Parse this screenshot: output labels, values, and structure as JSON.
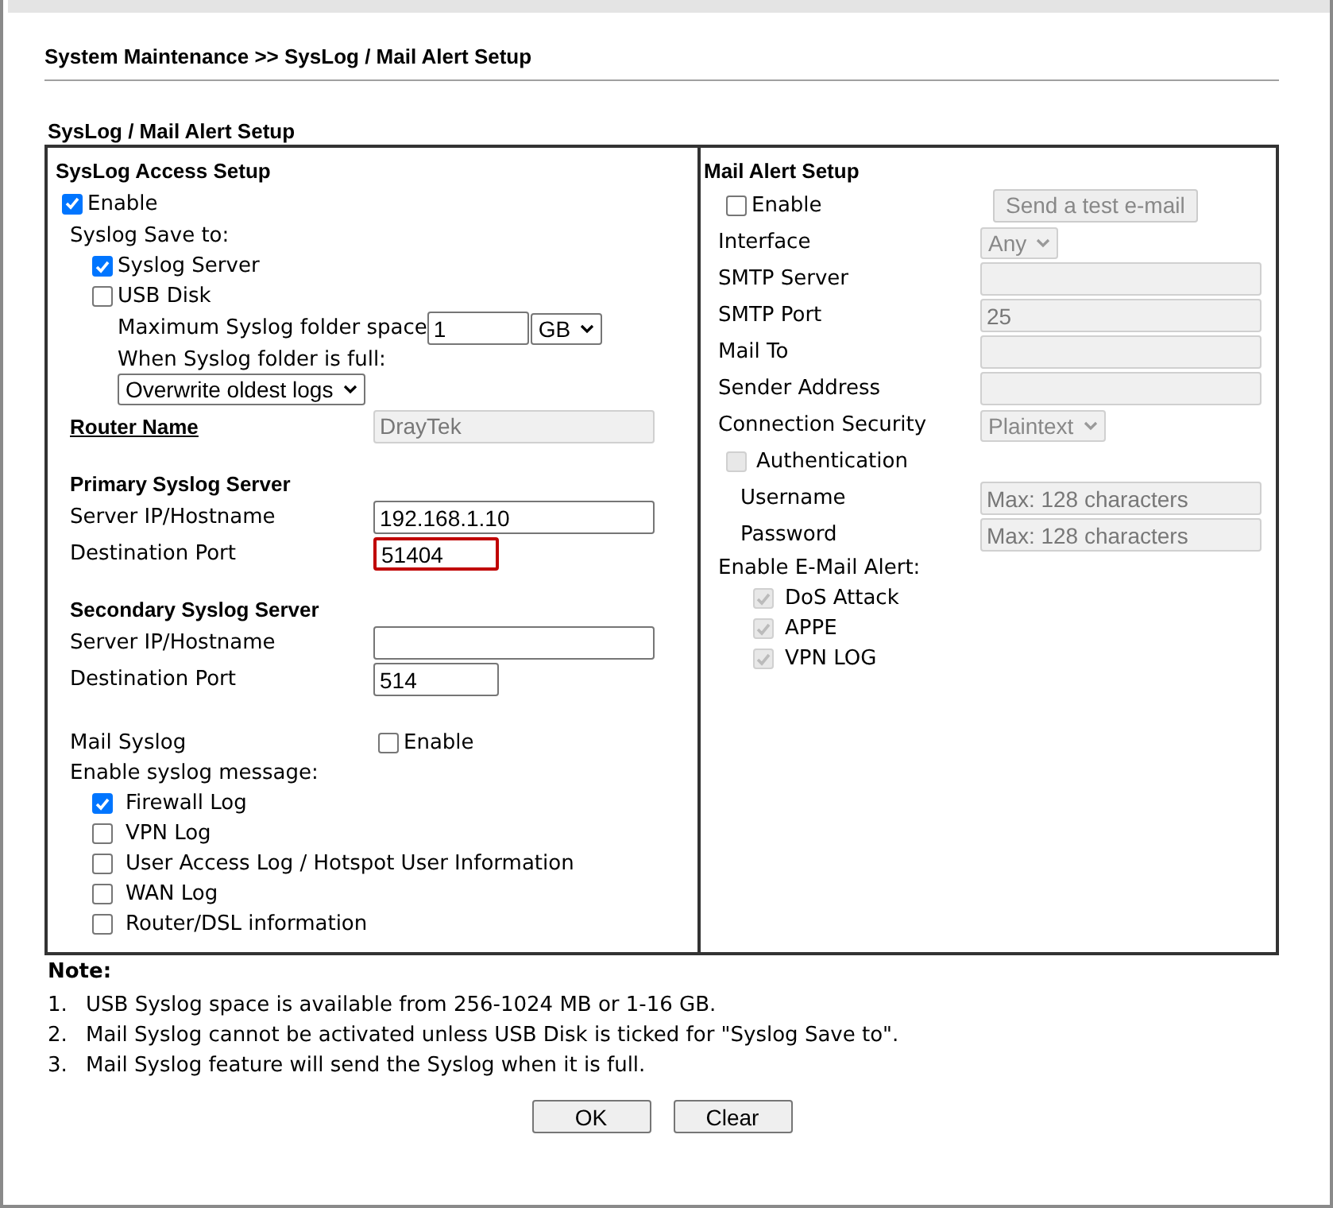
{
  "breadcrumb": "System Maintenance >> SysLog / Mail Alert Setup",
  "section_title": "SysLog / Mail Alert Setup",
  "syslog": {
    "title": "SysLog Access Setup",
    "enable": {
      "label": "Enable",
      "checked": true
    },
    "save_to_label": "Syslog Save to:",
    "save_targets": [
      {
        "label": "Syslog Server",
        "checked": true
      },
      {
        "label": "USB Disk",
        "checked": false
      }
    ],
    "max_space": {
      "label": "Maximum Syslog folder space",
      "value": "1",
      "unit": "GB"
    },
    "full_label": "When Syslog folder is full:",
    "full_action": "Overwrite oldest logs",
    "router_name": {
      "label": "Router Name",
      "value": "DrayTek",
      "disabled": true
    },
    "servers": [
      {
        "title": "Primary Syslog Server",
        "fields": [
          {
            "label": "Server IP/Hostname",
            "value": "192.168.1.10",
            "error": false
          },
          {
            "label": "Destination Port",
            "value": "51404",
            "error": true
          }
        ]
      },
      {
        "title": "Secondary Syslog Server",
        "fields": [
          {
            "label": "Server IP/Hostname",
            "error": false
          },
          {
            "label": "Destination Port",
            "value": "514",
            "error": false
          }
        ]
      }
    ],
    "mail_syslog": {
      "label": "Mail Syslog",
      "checkbox_label": "Enable",
      "checked": false
    },
    "messages": {
      "label": "Enable syslog message:",
      "items": [
        {
          "label": "Firewall Log",
          "checked": true
        },
        {
          "label": "VPN Log",
          "checked": false
        },
        {
          "label": "User Access Log / Hotspot User Information",
          "checked": false
        },
        {
          "label": "WAN Log",
          "checked": false
        },
        {
          "label": "Router/DSL information",
          "checked": false
        }
      ]
    }
  },
  "mail_alert": {
    "title": "Mail Alert Setup",
    "enable": {
      "label": "Enable",
      "checked": false
    },
    "test_button": {
      "label": "Send a test e-mail",
      "disabled": true
    },
    "rows": [
      {
        "kind": "select",
        "label": "Interface",
        "value": "Any"
      },
      {
        "kind": "input",
        "label": "SMTP Server"
      },
      {
        "kind": "input",
        "label": "SMTP Port",
        "value": "25"
      },
      {
        "kind": "input",
        "label": "Mail To"
      },
      {
        "kind": "input",
        "label": "Sender Address"
      },
      {
        "kind": "select",
        "label": "Connection Security",
        "value": "Plaintext"
      },
      {
        "kind": "checkbox",
        "label": "Authentication",
        "checked": false,
        "children": [
          {
            "label": "Username",
            "placeholder": "Max: 128 characters"
          },
          {
            "label": "Password",
            "placeholder": "Max: 128 characters"
          }
        ]
      }
    ],
    "alerts": {
      "label": "Enable E-Mail Alert:",
      "items": [
        {
          "label": "DoS Attack",
          "checked": true
        },
        {
          "label": "APPE",
          "checked": true
        },
        {
          "label": "VPN LOG",
          "checked": true
        }
      ]
    }
  },
  "notes": {
    "title": "Note:",
    "items": [
      {
        "number": "1.",
        "text": "USB Syslog space is available from 256-1024 MB or 1-16 GB."
      },
      {
        "number": "2.",
        "text": "Mail Syslog cannot be activated unless USB Disk is ticked for \"Syslog Save to\"."
      },
      {
        "number": "3.",
        "text": "Mail Syslog feature will send the Syslog when it is full."
      }
    ]
  },
  "buttons": [
    "OK",
    "Clear"
  ]
}
